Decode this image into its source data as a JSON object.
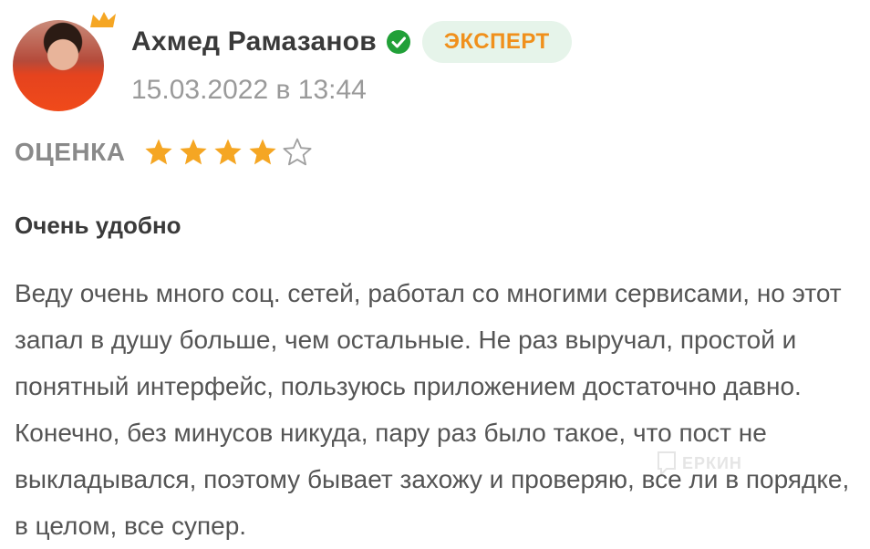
{
  "review": {
    "author_name": "Ахмед Рамазанов",
    "badge": "ЭКСПЕРТ",
    "date": "15.03.2022 в 13:44",
    "rating_label": "ОЦЕНКА",
    "rating": 4,
    "rating_max": 5,
    "title": "Очень удобно",
    "text": "Веду очень много соц. сетей, работал со многими сервисами, но этот запал в душу больше, чем остальные. Не раз выручал, простой и понятный интерфейс, пользуюсь приложением достаточно давно. Конечно, без минусов никуда, пару раз было такое, что пост не выкладывался, поэтому бывает захожу и проверяю, все ли в порядке, в целом, все супер."
  },
  "watermark": "ЕРКИН",
  "colors": {
    "star_filled": "#f5a623",
    "badge_bg": "#e6f4ea",
    "badge_text": "#f0901c",
    "verified": "#21a038"
  },
  "icons": [
    "crown-icon",
    "verified-check-icon",
    "star-icon",
    "star-outline-icon"
  ]
}
